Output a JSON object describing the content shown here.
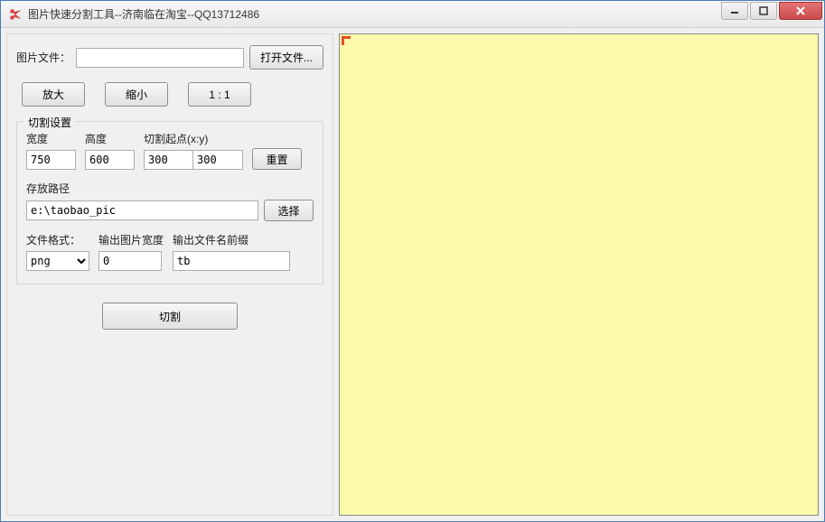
{
  "window": {
    "title": "图片快速分割工具--济南临在淘宝--QQ13712486"
  },
  "fileRow": {
    "label": "图片文件：",
    "value": "",
    "openButton": "打开文件..."
  },
  "zoom": {
    "in": "放大",
    "out": "缩小",
    "one": "1 : 1"
  },
  "cutSettings": {
    "legend": "切割设置",
    "widthLabel": "宽度",
    "widthValue": "750",
    "heightLabel": "高度",
    "heightValue": "600",
    "startLabel": "切割起点(x:y)",
    "startX": "300",
    "startY": "300",
    "resetButton": "重置",
    "savePathLabel": "存放路径",
    "savePathValue": "e:\\taobao_pic",
    "selectButton": "选择",
    "fileFormatLabel": "文件格式：",
    "fileFormatValue": "png",
    "outWidthLabel": "输出图片宽度",
    "outWidthValue": "0",
    "prefixLabel": "输出文件名前缀",
    "prefixValue": "tb"
  },
  "cutButton": "切割"
}
